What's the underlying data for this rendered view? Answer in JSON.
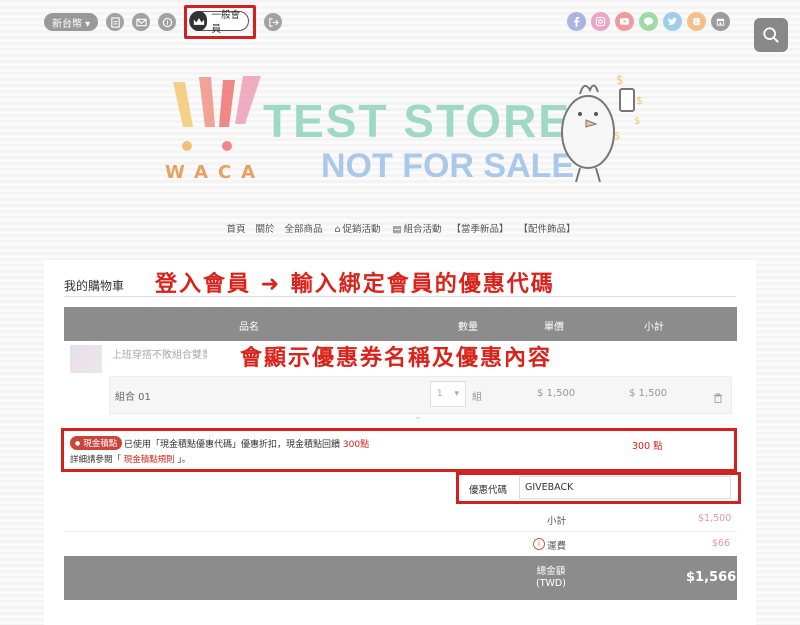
{
  "topbar": {
    "currency": "新台幣 ▾",
    "member_level": "一般會員"
  },
  "logo": {
    "line1": "TEST STORE",
    "line2": "NOT FOR SALE",
    "brand": "WACA"
  },
  "nav": [
    "首頁",
    "關於",
    "全部商品",
    "促銷活動",
    "組合活動",
    "【當季新品】",
    "【配件飾品】"
  ],
  "cart": {
    "title": "我的購物車",
    "annotation_top": "登入會員 ➜ 輸入綁定會員的優惠代碼",
    "annotation_mid": "會顯示優惠券名稱及優惠內容",
    "columns": {
      "name": "品名",
      "qty": "數量",
      "price": "單價",
      "subtotal": "小計"
    },
    "item_name": "上班穿搭不敗組合雙重優惠",
    "combo": {
      "label": "組合 01",
      "qty": "1",
      "unit": "組",
      "price": "$ 1,500",
      "subtotal": "$ 1,500"
    },
    "promo": {
      "badge": "現金積點",
      "text_before": "已使用「現金積點優惠代碼」優惠折扣，現金積點回饋",
      "text_amount": "300點",
      "detail_before": "詳細請參閱「",
      "detail_link": "現金積點規則",
      "detail_after": "」。",
      "points": "300 點"
    },
    "coupon": {
      "label": "優惠代碼",
      "value": "GIVEBACK"
    },
    "summary": {
      "subtotal_label": "小計",
      "subtotal_value": "$1,500",
      "shipping_label": "運費",
      "shipping_value": "$66",
      "total_label_line1": "總金額",
      "total_label_line2": "(TWD)",
      "total_value": "$1,566"
    }
  },
  "colors": {
    "annotation_red": "#d8221a",
    "header_gray": "#8c8c8c",
    "badge_red": "#c9443a"
  }
}
